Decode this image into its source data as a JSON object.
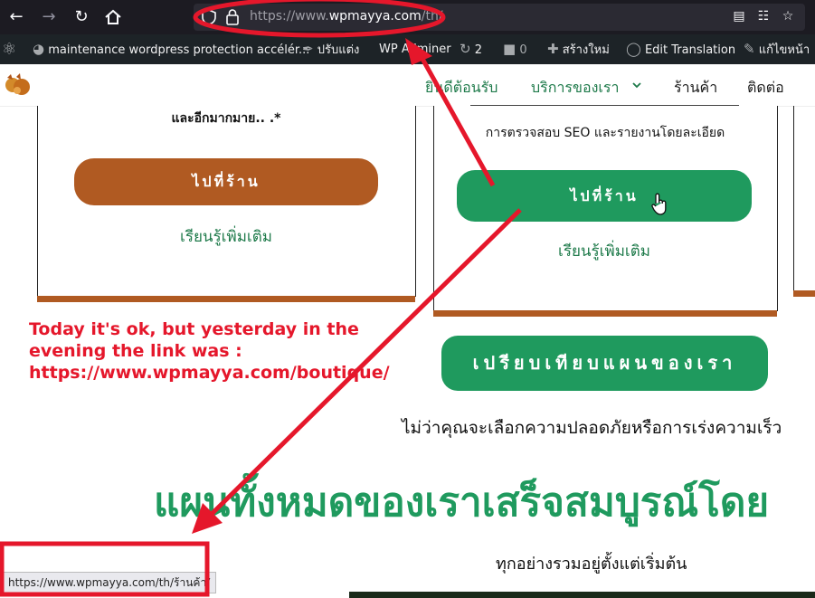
{
  "browser": {
    "back_icon": "arrow-left-icon",
    "forward_icon": "arrow-right-icon",
    "reload_icon": "reload-icon",
    "home_icon": "home-icon",
    "url_prefix": "https://www.",
    "url_host": "wpmayya.com",
    "url_path": "/th/"
  },
  "admin_bar": {
    "site_name": "maintenance wordpress protection accélér...",
    "customize": "ปรับแต่ง",
    "plugin": "WP Adminer",
    "updates": "2",
    "comments": "0",
    "new_item": "สร้างใหม่",
    "translate": "Edit Translation",
    "edit_page": "แก้ไขหน้า"
  },
  "header": {
    "menu": {
      "welcome": "ยินดีต้อนรับ",
      "services": "บริการของเรา",
      "shop": "ร้านค้า",
      "contact": "ติดต่อ"
    }
  },
  "cards": {
    "left": {
      "feature_text": "และอีกมากมาย.. .*",
      "shop_button": "ไปที่ร้าน",
      "learn_more": "เรียนรู้เพิ่มเติม"
    },
    "middle": {
      "feature_text": "การตรวจสอบ SEO และรายงานโดยละเอียด",
      "shop_button": "ไปที่ร้าน",
      "learn_more": "เรียนรู้เพิ่มเติม"
    }
  },
  "annotation": {
    "line1": "Today it's ok, but yesterday in the",
    "line2": "evening the link was :",
    "line3": "https://www.wpmayya.com/boutique/"
  },
  "compare_button": "เปรียบเทียบแผนของเรา",
  "tagline": "ไม่ว่าคุณจะเลือกความปลอดภัยหรือการเร่งความเร็ว",
  "big_heading": "แผนทั้งหมดของเราเสร็จสมบูรณ์โดย",
  "sub_heading": "ทุกอย่างรวมอยู่ตั้งแต่เริ่มต้น",
  "status_link": "https://www.wpmayya.com/th/ร้านค้า/",
  "colors": {
    "brown": "#b05a22",
    "green": "#1f9a5e",
    "red_annotation": "#e5172b"
  }
}
